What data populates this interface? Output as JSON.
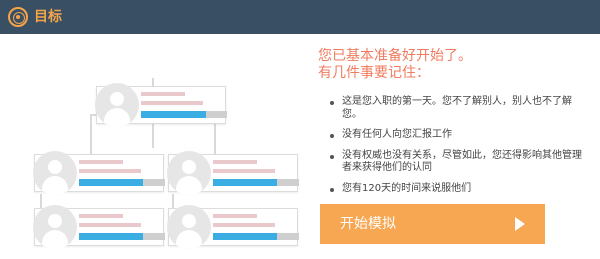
{
  "header": {
    "icon": "target-icon",
    "title": "目标",
    "accent_color": "#f5a44a",
    "background_color": "#394f63"
  },
  "info": {
    "title_line1": "您已基本准备好开始了。",
    "title_line2": "有几件事要记住：",
    "bullets": [
      "这是您入职的第一天。您不了解别人，别人也不了解您。",
      "没有任何人向您汇报工作",
      "没有权威也没有关系，尽管如此，您还得影响其他管理者来获得他们的认同",
      "您有120天的时间来说服他们"
    ]
  },
  "start_button": {
    "label": "开始模拟",
    "icon": "play-icon",
    "color": "#f7a651"
  },
  "org_chart": {
    "icon": "person-avatar-icon",
    "bar_color": "#3aaee2",
    "cards": [
      {
        "id": "root",
        "progress": 0.76
      },
      {
        "id": "mid-left",
        "progress": 0.74
      },
      {
        "id": "mid-right",
        "progress": 0.74
      },
      {
        "id": "bottom-left",
        "progress": 0.74
      },
      {
        "id": "bottom-right",
        "progress": 0.74
      }
    ]
  }
}
